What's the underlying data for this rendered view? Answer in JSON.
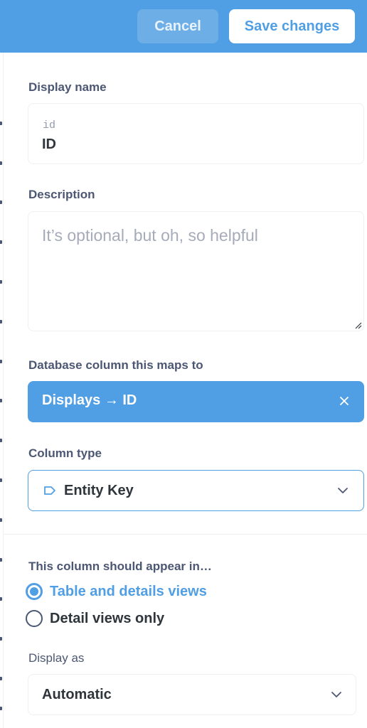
{
  "header": {
    "cancel_label": "Cancel",
    "save_label": "Save changes",
    "background_color": "#509ee3"
  },
  "form": {
    "display_name": {
      "label": "Display name",
      "original_name": "id",
      "value": "ID"
    },
    "description": {
      "label": "Description",
      "placeholder": "It’s optional, but oh, so helpful",
      "value": ""
    },
    "database_column": {
      "label": "Database column this maps to",
      "value": "Displays → ID",
      "clear_icon": "close-icon"
    },
    "column_type": {
      "label": "Column type",
      "icon": "tag-icon",
      "value": "Entity Key",
      "dropdown_icon": "chevron-down-icon"
    },
    "visibility": {
      "label": "This column should appear in…",
      "options": [
        {
          "label": "Table and details views",
          "selected": true
        },
        {
          "label": "Detail views only",
          "selected": false
        }
      ]
    },
    "display_as": {
      "label": "Display as",
      "value": "Automatic",
      "dropdown_icon": "chevron-down-icon"
    }
  },
  "colors": {
    "accent": "#509ee3",
    "text_dark": "#2e353b",
    "text_medium": "#4c5773",
    "placeholder": "#a5abb8",
    "border": "#eef0f3"
  }
}
